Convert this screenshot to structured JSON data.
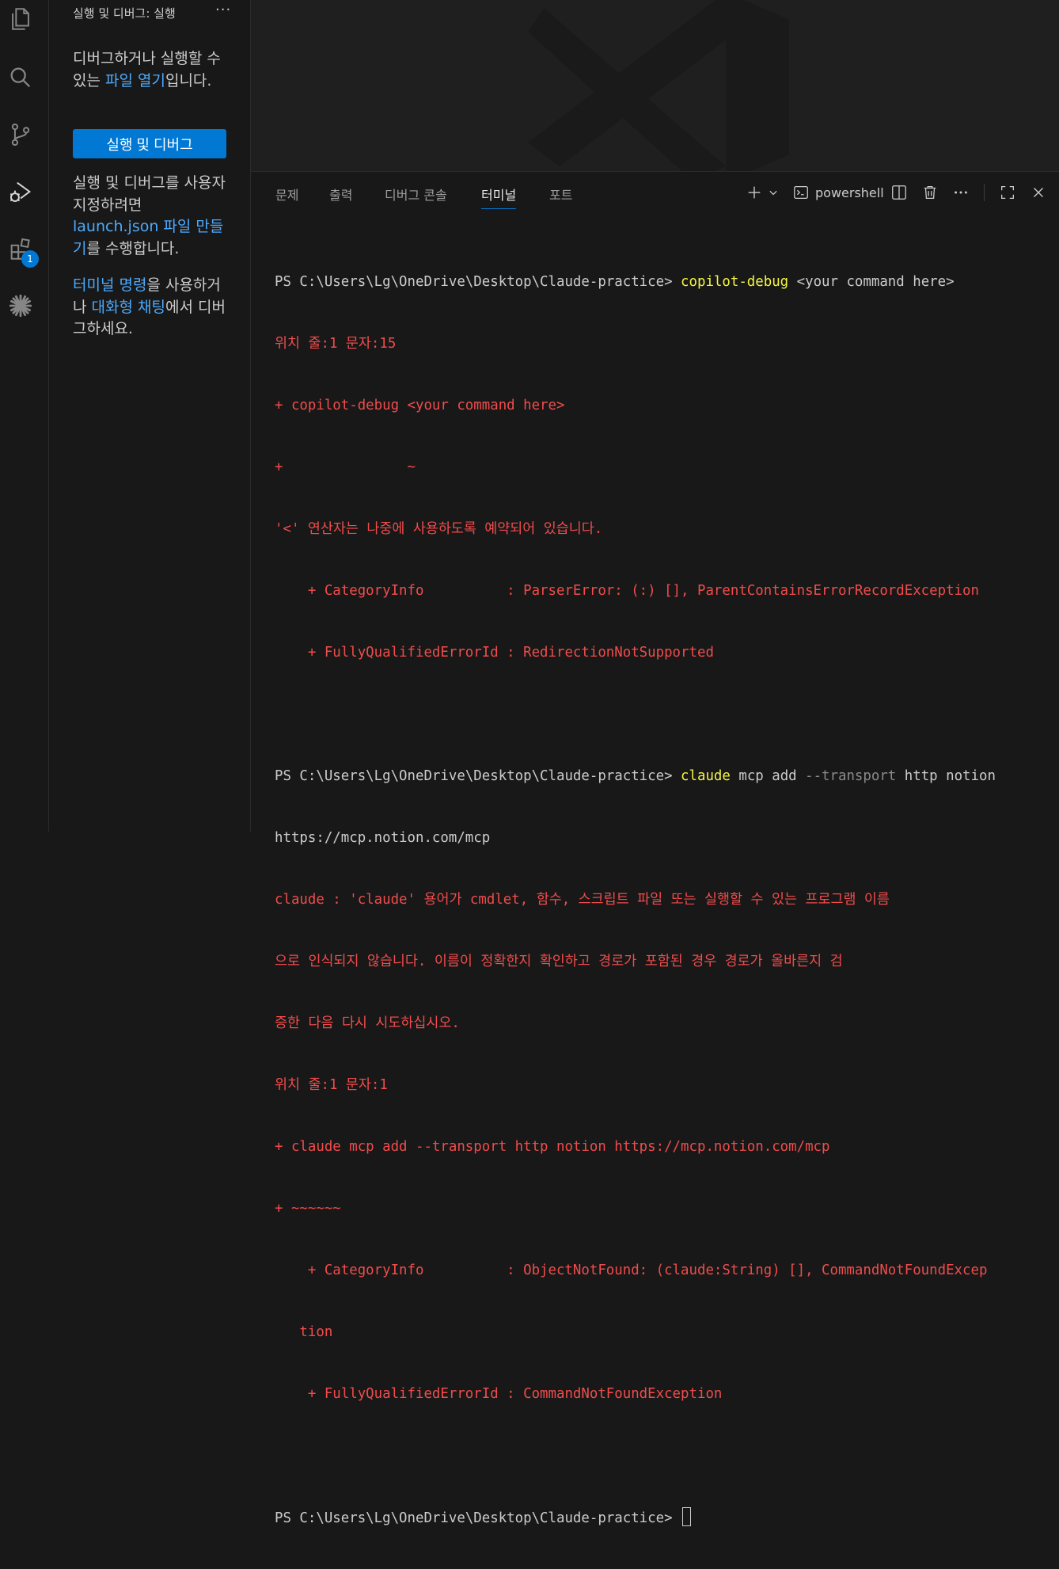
{
  "sidebar": {
    "title": "실행 및 디버그: 실행",
    "more": "···",
    "intro_1": "디버그하거나 실행할 수 있는 ",
    "intro_link": "파일 열기",
    "intro_2": "입니다.",
    "run_button": "실행 및 디버그",
    "custom_1": "실행 및 디버그를 사용자 지정하려면 ",
    "custom_link": "launch.json 파일 만들기",
    "custom_2": "를 수행합니다.",
    "term_link": "터미널 명령",
    "term_mid": "을 사용하거나 ",
    "chat_link": "대화형 채팅",
    "term_end": "에서 디버그하세요."
  },
  "activity": {
    "extensions_badge": "1",
    "icons": [
      "files-icon",
      "search-icon",
      "source-control-icon",
      "run-debug-icon",
      "extensions-icon",
      "claude-icon"
    ]
  },
  "panel": {
    "tabs": [
      "문제",
      "출력",
      "디버그 콘솔",
      "터미널",
      "포트"
    ],
    "active_tab": "터미널",
    "shell_name": "powershell"
  },
  "terminal": {
    "prompt": "PS C:\\Users\\Lg\\OneDrive\\Desktop\\Claude-practice>",
    "cmd1": "copilot-debug",
    "cmd1_rest": " <your command here>",
    "err1": [
      "위치 줄:1 문자:15",
      "+ copilot-debug <your command here>",
      "+               ~",
      "'<' 연산자는 나중에 사용하도록 예약되어 있습니다.",
      "    + CategoryInfo          : ParserError: (:) [], ParentContainsErrorRecordException",
      "    + FullyQualifiedErrorId : RedirectionNotSupported"
    ],
    "cmd2": "claude",
    "cmd2_a": " mcp add ",
    "cmd2_param": "--transport",
    "cmd2_b": " http notion",
    "cmd2_wrap": "https://mcp.notion.com/mcp",
    "err2": [
      "claude : 'claude' 용어가 cmdlet, 함수, 스크립트 파일 또는 실행할 수 있는 프로그램 이름",
      "으로 인식되지 않습니다. 이름이 정확한지 확인하고 경로가 포함된 경우 경로가 올바른지 검",
      "증한 다음 다시 시도하십시오.",
      "위치 줄:1 문자:1",
      "+ claude mcp add --transport http notion https://mcp.notion.com/mcp",
      "+ ~~~~~~",
      "    + CategoryInfo          : ObjectNotFound: (claude:String) [], CommandNotFoundExcep",
      "   tion",
      "    + FullyQualifiedErrorId : CommandNotFoundException"
    ]
  },
  "colors": {
    "accent": "#0078d4",
    "link": "#4daafc",
    "error": "#f14c4c",
    "command": "#f5f543"
  }
}
